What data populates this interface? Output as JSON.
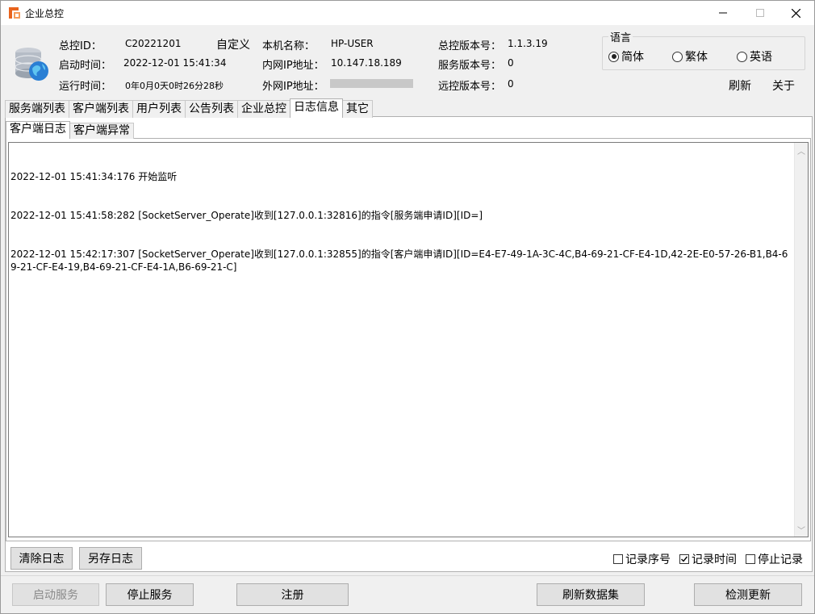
{
  "window": {
    "title": "企业总控",
    "minimize_symbol": "—",
    "maximize_symbol": "☐",
    "close_symbol": "✕",
    "accent_color": "#e8641e"
  },
  "info": {
    "master_id_label": "总控ID：",
    "master_id_value": "C20221201",
    "custom_label": "自定义",
    "host_name_label": "本机名称：",
    "host_name_value": "HP-USER",
    "master_version_label": "总控版本号：",
    "master_version_value": "1.1.3.19",
    "start_time_label": "启动时间：",
    "start_time_value": "2022-12-01 15:41:34",
    "lan_ip_label": "内网IP地址：",
    "lan_ip_value": "10.147.18.189",
    "service_version_label": "服务版本号：",
    "service_version_value": "0",
    "run_time_label": "运行时间：",
    "run_time_value": "0年0月0天0时26分28秒",
    "wan_ip_label": "外网IP地址：",
    "remote_version_label": "远控版本号：",
    "remote_version_value": "0"
  },
  "language": {
    "legend": "语言",
    "options": [
      "简体",
      "繁体",
      "英语"
    ],
    "selected": "简体"
  },
  "links": {
    "refresh": "刷新",
    "about": "关于"
  },
  "tabs": [
    "服务端列表",
    "客户端列表",
    "用户列表",
    "公告列表",
    "企业总控",
    "日志信息",
    "其它"
  ],
  "active_tab": "日志信息",
  "subtabs": [
    "客户端日志",
    "客户端异常"
  ],
  "active_subtab": "客户端日志",
  "log_lines": [
    "2022-12-01 15:41:34:176 开始监听",
    "2022-12-01 15:41:58:282 [SocketServer_Operate]收到[127.0.0.1:32816]的指令[服务端申请ID][ID=]",
    "2022-12-01 15:42:17:307 [SocketServer_Operate]收到[127.0.0.1:32855]的指令[客户端申请ID][ID=E4-E7-49-1A-3C-4C,B4-69-21-CF-E4-1D,42-2E-E0-57-26-B1,B4-69-21-CF-E4-19,B4-69-21-CF-E4-1A,B6-69-21-C]"
  ],
  "log_buttons": {
    "clear": "清除日志",
    "save_as": "另存日志"
  },
  "log_options": [
    {
      "label": "记录序号",
      "checked": false
    },
    {
      "label": "记录时间",
      "checked": true
    },
    {
      "label": "停止记录",
      "checked": false
    }
  ],
  "bottom_buttons": {
    "start_service": "启动服务",
    "stop_service": "停止服务",
    "register": "注册",
    "refresh_dataset": "刷新数据集",
    "check_update": "检测更新"
  },
  "scroll_up_symbol": "︿",
  "scroll_down_symbol": "﹀"
}
